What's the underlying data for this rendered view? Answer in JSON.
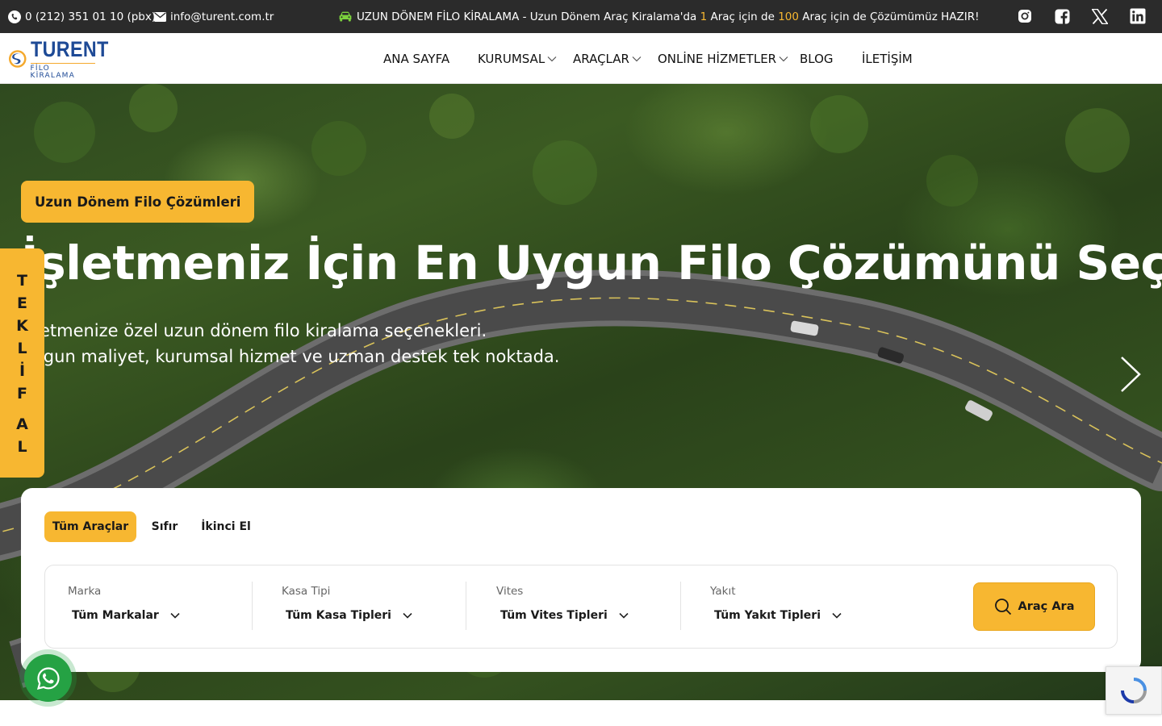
{
  "topbar": {
    "phone": "0 (212) 351 01 10 (pbx)",
    "email": "info@turent.com.tr",
    "promo_prefix": "UZUN DÖNEM FİLO KİRALAMA - Uzun Dönem Araç Kiralama'da ",
    "promo_num1": "1",
    "promo_mid": " Araç için de ",
    "promo_num2": "100",
    "promo_suffix": " Araç için de Çözümümüz HAZIR!",
    "social": [
      "instagram-icon",
      "facebook-icon",
      "x-icon",
      "linkedin-icon"
    ]
  },
  "header": {
    "logo_main": "TURENT",
    "logo_sub": "FİLO KİRALAMA",
    "nav": [
      {
        "label": "ANA SAYFA",
        "dropdown": false
      },
      {
        "label": "KURUMSAL",
        "dropdown": true
      },
      {
        "label": "ARAÇLAR",
        "dropdown": true
      },
      {
        "label": "ONLİNE HİZMETLER",
        "dropdown": true
      },
      {
        "label": "BLOG",
        "dropdown": false
      },
      {
        "label": "İLETİŞİM",
        "dropdown": false
      }
    ]
  },
  "hero": {
    "badge": "Uzun Dönem Filo Çözümleri",
    "title": "İşletmeniz İçin En Uygun Filo Çözümünü Seçin",
    "subtitle_line1": "İşletmenize özel uzun dönem filo kiralama seçenekleri.",
    "subtitle_line2": "Uygun maliyet, kurumsal hizmet ve uzman destek tek noktada."
  },
  "teklif_al": [
    "T",
    "E",
    "K",
    "L",
    "İ",
    "F",
    "",
    "A",
    "L"
  ],
  "search": {
    "tabs": [
      "Tüm Araçlar",
      "Sıfır",
      "İkinci El"
    ],
    "active_tab": 0,
    "filters": [
      {
        "label": "Marka",
        "value": "Tüm Markalar"
      },
      {
        "label": "Kasa Tipi",
        "value": "Tüm Kasa Tipleri"
      },
      {
        "label": "Vites",
        "value": "Tüm Vites Tipleri"
      },
      {
        "label": "Yakıt",
        "value": "Tüm Yakıt Tipleri"
      }
    ],
    "button": "Araç Ara"
  },
  "colors": {
    "accent": "#f7b731",
    "topbar": "#2b2b2b",
    "brand": "#1e4a96",
    "whatsapp": "#25a244"
  }
}
